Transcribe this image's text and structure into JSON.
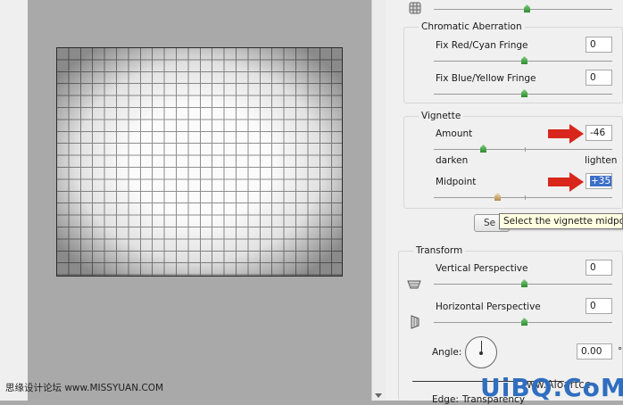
{
  "chromatic": {
    "title": "Chromatic Aberration",
    "red_cyan_label": "Fix Red/Cyan Fringe",
    "red_cyan_value": "0",
    "blue_yellow_label": "Fix Blue/Yellow Fringe",
    "blue_yellow_value": "0"
  },
  "vignette": {
    "title": "Vignette",
    "amount_label": "Amount",
    "amount_value": "-46",
    "darken_label": "darken",
    "lighten_label": "lighten",
    "midpoint_label": "Midpoint",
    "midpoint_value": "+35",
    "set_button_label": "Se",
    "tooltip": "Select the vignette midpo"
  },
  "transform": {
    "title": "Transform",
    "vertical_label": "Vertical Perspective",
    "vertical_value": "0",
    "horizontal_label": "Horizontal Perspective",
    "horizontal_value": "0",
    "angle_label": "Angle:",
    "angle_value": "0.00",
    "angle_unit": "°"
  },
  "bottom": {
    "edge_label": "Edge:",
    "edge_value": "Transparency"
  },
  "watermark": {
    "left_text": "思缘设计论坛 www.MISSYUAN.COM",
    "brand_text": "UiBQ.CoM",
    "partial_text": "ww.Aloartcc"
  },
  "colors": {
    "arrow_red": "#d9261c",
    "selection_blue": "#3d6fc8",
    "brand_blue": "#2f6ec0"
  }
}
